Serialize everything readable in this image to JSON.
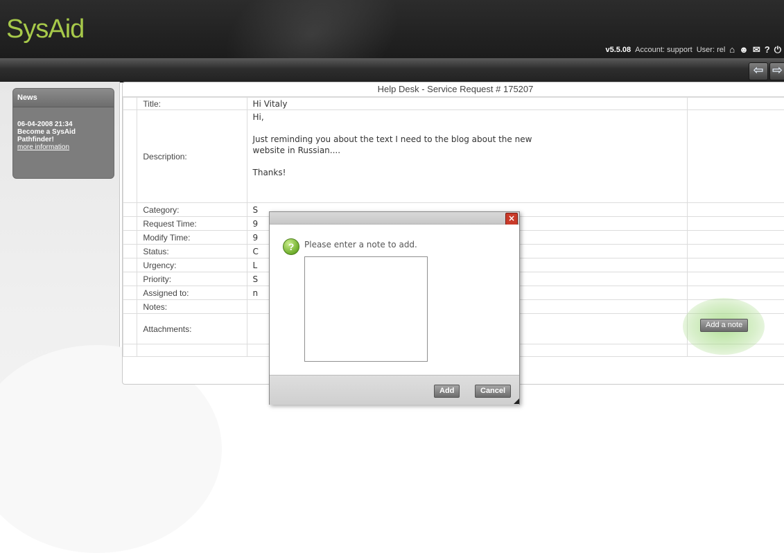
{
  "app": {
    "logo_text": "SysAid",
    "version": "v5.5.08",
    "account_label": "Account: support",
    "user_label": "User: rel"
  },
  "header_icons": [
    "home-icon",
    "user-icon",
    "mail-icon",
    "help-icon",
    "power-icon"
  ],
  "nav": {
    "back_label": "⇦",
    "forward_label": "⇨"
  },
  "sidebar": {
    "news": {
      "title": "News",
      "date": "06-04-2008 21:34",
      "headline_line1": "Become a SysAid",
      "headline_line2": "Pathfinder!",
      "link": "more information"
    }
  },
  "panel": {
    "title": "Help Desk - Service Request # 175207",
    "rows": [
      {
        "label": "Title:",
        "value": "Hi Vitaly"
      },
      {
        "label": "Description:",
        "value": "Hi,\n\nJust reminding you about the text I need to the blog about the new\nwebsite in Russian....\n\nThanks!"
      },
      {
        "label": "Category:",
        "value": "S"
      },
      {
        "label": "Request Time:",
        "value": "9"
      },
      {
        "label": "Modify Time:",
        "value": "9"
      },
      {
        "label": "Status:",
        "value": "C"
      },
      {
        "label": "Urgency:",
        "value": "L"
      },
      {
        "label": "Priority:",
        "value": "S"
      },
      {
        "label": "Assigned to:",
        "value": "n"
      },
      {
        "label": "Notes:",
        "value": ""
      },
      {
        "label": "Attachments:",
        "value": ""
      }
    ],
    "add_note_button": "Add a note"
  },
  "modal": {
    "close_label": "×",
    "prompt": "Please enter a note to add.",
    "textarea_value": "",
    "add_button": "Add",
    "cancel_button": "Cancel"
  },
  "colors": {
    "logo_green": "#a7c94a",
    "header_dark": "#232323",
    "close_red": "#c93b2a",
    "highlight_green": "#9bd778"
  }
}
